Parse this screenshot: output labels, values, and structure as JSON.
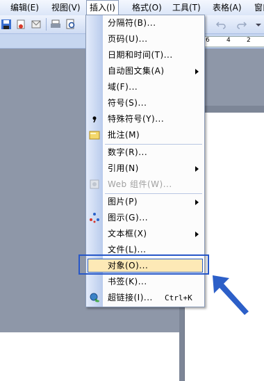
{
  "menubar": {
    "items": [
      {
        "label": "编辑(E)"
      },
      {
        "label": "视图(V)"
      },
      {
        "label": "插入(I)"
      },
      {
        "label": "格式(O)"
      },
      {
        "label": "工具(T)"
      },
      {
        "label": "表格(A)"
      },
      {
        "label": "窗口"
      }
    ]
  },
  "ruler": {
    "ticks": [
      "6",
      "4",
      "2"
    ]
  },
  "insert_menu": {
    "items": [
      {
        "label": "分隔符(B)...",
        "has_submenu": false
      },
      {
        "label": "页码(U)...",
        "has_submenu": false
      },
      {
        "label": "日期和时间(T)...",
        "has_submenu": false
      },
      {
        "label": "自动图文集(A)",
        "has_submenu": true
      },
      {
        "label": "域(F)...",
        "has_submenu": false
      },
      {
        "label": "符号(S)...",
        "has_submenu": false
      },
      {
        "label": "特殊符号(Y)...",
        "has_submenu": false
      },
      {
        "label": "批注(M)",
        "has_submenu": false
      },
      {
        "label": "数字(R)...",
        "has_submenu": false
      },
      {
        "label": "引用(N)",
        "has_submenu": true
      },
      {
        "label": "Web 组件(W)...",
        "has_submenu": false,
        "disabled": true
      },
      {
        "label": "图片(P)",
        "has_submenu": true
      },
      {
        "label": "图示(G)...",
        "has_submenu": false
      },
      {
        "label": "文本框(X)",
        "has_submenu": true
      },
      {
        "label": "文件(L)...",
        "has_submenu": false
      },
      {
        "label": "对象(O)...",
        "has_submenu": false,
        "highlighted": true
      },
      {
        "label": "书签(K)...",
        "has_submenu": false
      },
      {
        "label": "超链接(I)...",
        "shortcut": "Ctrl+K",
        "has_submenu": false
      }
    ]
  },
  "colors": {
    "highlight_fill": "#fde9b6",
    "callout_blue": "#2757c8"
  }
}
